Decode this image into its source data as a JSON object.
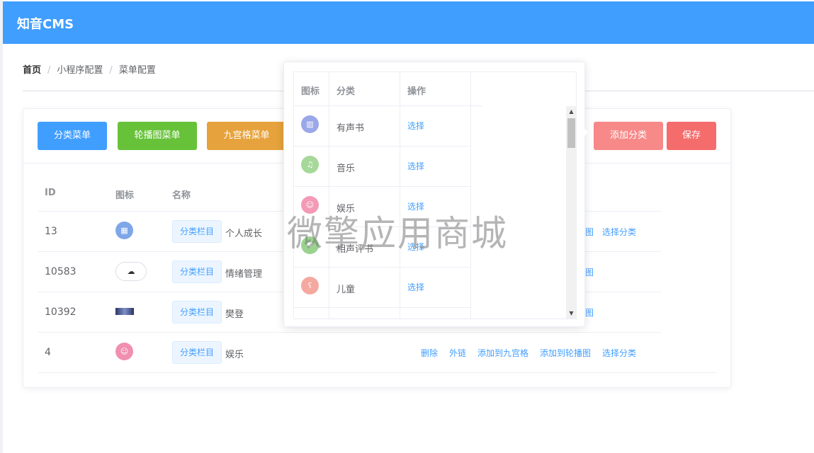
{
  "app": {
    "title": "知音CMS"
  },
  "breadcrumb": {
    "home": "首页",
    "sep": "/",
    "level2": "小程序配置",
    "level3": "菜单配置"
  },
  "toolbar": {
    "category_menu": "分类菜单",
    "carousel_menu": "轮播图菜单",
    "grid_menu": "九宫格菜单",
    "add_category": "添加分类",
    "save": "保存"
  },
  "table": {
    "headers": {
      "id": "ID",
      "icon": "图标",
      "name": "名称"
    },
    "rows": [
      {
        "id": "13",
        "tag": "分类栏目",
        "name": "个人成长",
        "actions": [
          "图",
          "选择分类"
        ],
        "icon": "calendar-icon",
        "color": "#7ea6e8"
      },
      {
        "id": "10583",
        "tag": "分类栏目",
        "name": "情绪管理",
        "actions": [
          "图"
        ],
        "icon": "cloud-upload-icon",
        "color": "#ffffff"
      },
      {
        "id": "10392",
        "tag": "分类栏目",
        "name": "樊登",
        "actions": [
          "图"
        ],
        "icon": "thumbnail-image",
        "color": "#3a4680"
      },
      {
        "id": "4",
        "tag": "分类栏目",
        "name": "娱乐",
        "actions": [
          "删除",
          "外链",
          "添加到九宫格",
          "添加到轮播图",
          "选择分类"
        ],
        "icon": "smile-icon",
        "color": "#f08fb0"
      }
    ]
  },
  "popover": {
    "headers": {
      "icon": "图标",
      "category": "分类",
      "action": "操作"
    },
    "rows": [
      {
        "name": "有声书",
        "action": "选择",
        "icon": "book-icon",
        "color": "#9aa7e8"
      },
      {
        "name": "音乐",
        "action": "选择",
        "icon": "music-icon",
        "color": "#a6d89a"
      },
      {
        "name": "娱乐",
        "action": "选择",
        "icon": "smile-icon",
        "color": "#f39ab7"
      },
      {
        "name": "相声评书",
        "action": "选择",
        "icon": "heart-icon",
        "color": "#9ad38f"
      },
      {
        "name": "儿童",
        "action": "选择",
        "icon": "bear-icon",
        "color": "#f5a8a0"
      }
    ]
  },
  "watermark": "微擎应用商城"
}
